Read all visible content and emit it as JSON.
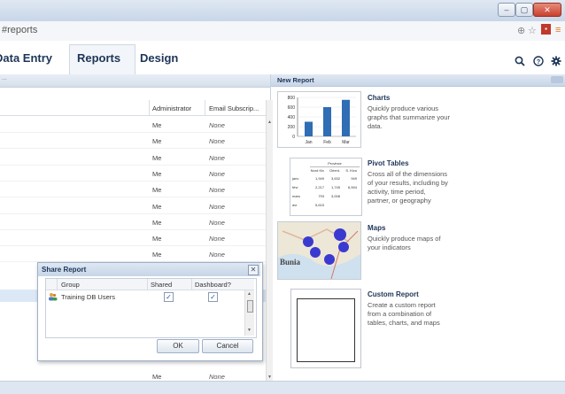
{
  "browser": {
    "url": "#reports",
    "window_buttons": [
      "–",
      "▢",
      "✕"
    ]
  },
  "nav": {
    "tabs": [
      "Data Entry",
      "Reports",
      "Design"
    ],
    "active_tab": "Reports"
  },
  "left": {
    "header_glyph": "...",
    "columns": [
      "Administrator",
      "Email Subscrip..."
    ],
    "rows": [
      {
        "admin": "Me",
        "email": "None"
      },
      {
        "admin": "Me",
        "email": "None"
      },
      {
        "admin": "Me",
        "email": "None"
      },
      {
        "admin": "Me",
        "email": "None"
      },
      {
        "admin": "Me",
        "email": "None"
      },
      {
        "admin": "Me",
        "email": "None"
      },
      {
        "admin": "Me",
        "email": "None"
      },
      {
        "admin": "Me",
        "email": "None"
      },
      {
        "admin": "Me",
        "email": "None"
      }
    ],
    "last_row": {
      "admin": "Me",
      "email": "None"
    }
  },
  "dialog": {
    "title": "Share Report",
    "columns": [
      "Group",
      "Shared",
      "Dashboard?"
    ],
    "rows": [
      {
        "group": "Training DB Users",
        "shared": true,
        "dashboard": true
      }
    ],
    "ok_label": "OK",
    "cancel_label": "Cancel"
  },
  "new_report": {
    "title": "New Report",
    "options": [
      {
        "title": "Charts",
        "description": "Quickly produce various graphs that summarize your data."
      },
      {
        "title": "Pivot Tables",
        "description": "Cross all of the dimensions of your results, including by activity, time period, partner, or geography"
      },
      {
        "title": "Maps",
        "description": "Quickly produce maps of your indicators"
      },
      {
        "title": "Custom Report",
        "description": "Create a custom report from a combination of tables, charts, and maps"
      }
    ],
    "chart_thumb": {
      "y_ticks": [
        "800",
        "600",
        "400",
        "200",
        "0"
      ],
      "x_labels": [
        "Jan",
        "Feb",
        "Mar"
      ],
      "values": [
        300,
        600,
        750
      ]
    },
    "pivot_thumb": {
      "header": "Province",
      "cols": [
        "Nord Kiv",
        "Orient.",
        "S. Kivu"
      ],
      "rows": [
        [
          "janv",
          "1,949",
          "3,632",
          "949"
        ],
        [
          "févr",
          "2,217",
          "1,745",
          "6,594"
        ],
        [
          "mars",
          "793",
          "3,008",
          ""
        ],
        [
          "avr",
          "5,615",
          "",
          ""
        ]
      ]
    },
    "map_thumb": {
      "place_label": "Bunia"
    }
  },
  "colors": {
    "accent": "#1d3557",
    "bar": "#2f6db5",
    "map_dot": "#3a3ad0"
  }
}
